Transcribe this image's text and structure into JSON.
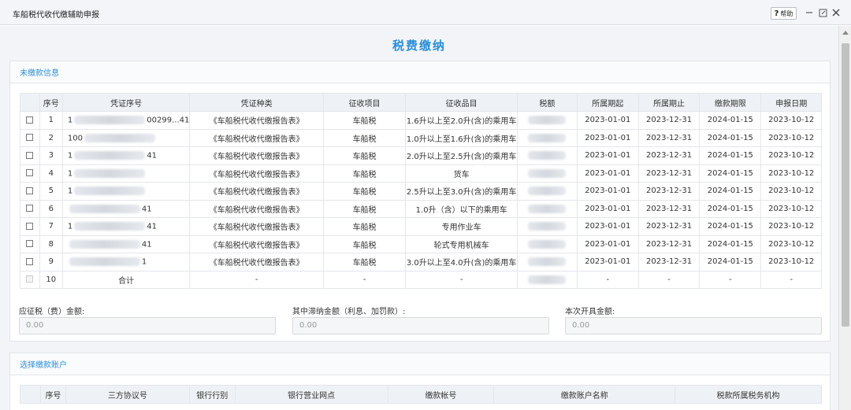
{
  "window": {
    "title": "车船税代收代缴辅助申报",
    "help_label": "帮助"
  },
  "page": {
    "title": "税费缴纳"
  },
  "unpaid": {
    "header": "未缴款信息",
    "columns": [
      "序号",
      "凭证序号",
      "凭证种类",
      "征收项目",
      "征收品目",
      "税额",
      "所属期起",
      "所属期止",
      "缴款期限",
      "申报日期"
    ],
    "rows": [
      {
        "no": "1",
        "voucher_no_visible": "1",
        "voucher_tail": "00299...41",
        "type": "《车船税代收代缴报告表》",
        "project": "车船税",
        "item": "1.6升以上至2.0升(含)的乘用车",
        "start": "2023-01-01",
        "end": "2023-12-31",
        "due": "2024-01-15",
        "date": "2023-10-12"
      },
      {
        "no": "2",
        "voucher_no_visible": "100",
        "voucher_tail": "",
        "type": "《车船税代收代缴报告表》",
        "project": "车船税",
        "item": "1.0升以上至1.6升(含)的乘用车",
        "start": "2023-01-01",
        "end": "2023-12-31",
        "due": "2024-01-15",
        "date": "2023-10-12"
      },
      {
        "no": "3",
        "voucher_no_visible": "1",
        "voucher_tail": "41",
        "type": "《车船税代收代缴报告表》",
        "project": "车船税",
        "item": "2.0升以上至2.5升(含)的乘用车",
        "start": "2023-01-01",
        "end": "2023-12-31",
        "due": "2024-01-15",
        "date": "2023-10-12"
      },
      {
        "no": "4",
        "voucher_no_visible": "1",
        "voucher_tail": "",
        "type": "《车船税代收代缴报告表》",
        "project": "车船税",
        "item": "货车",
        "start": "2023-01-01",
        "end": "2023-12-31",
        "due": "2024-01-15",
        "date": "2023-10-12"
      },
      {
        "no": "5",
        "voucher_no_visible": "1",
        "voucher_tail": "",
        "type": "《车船税代收代缴报告表》",
        "project": "车船税",
        "item": "2.5升以上至3.0升(含)的乘用车",
        "start": "2023-01-01",
        "end": "2023-12-31",
        "due": "2024-01-15",
        "date": "2023-10-12"
      },
      {
        "no": "6",
        "voucher_no_visible": "",
        "voucher_tail": "41",
        "type": "《车船税代收代缴报告表》",
        "project": "车船税",
        "item": "1.0升（含）以下的乘用车",
        "start": "2023-01-01",
        "end": "2023-12-31",
        "due": "2024-01-15",
        "date": "2023-10-12"
      },
      {
        "no": "7",
        "voucher_no_visible": "1",
        "voucher_tail": "41",
        "type": "《车船税代收代缴报告表》",
        "project": "车船税",
        "item": "专用作业车",
        "start": "2023-01-01",
        "end": "2023-12-31",
        "due": "2024-01-15",
        "date": "2023-10-12"
      },
      {
        "no": "8",
        "voucher_no_visible": "",
        "voucher_tail": "41",
        "type": "《车船税代收代缴报告表》",
        "project": "车船税",
        "item": "轮式专用机械车",
        "start": "2023-01-01",
        "end": "2023-12-31",
        "due": "2024-01-15",
        "date": "2023-10-12"
      },
      {
        "no": "9",
        "voucher_no_visible": "",
        "voucher_tail": "1",
        "type": "《车船税代收代缴报告表》",
        "project": "车船税",
        "item": "3.0升以上至4.0升(含)的乘用车",
        "start": "2023-01-01",
        "end": "2023-12-31",
        "due": "2024-01-15",
        "date": "2023-10-12"
      }
    ],
    "total_row": {
      "no": "10",
      "label": "合计",
      "dash": "-"
    }
  },
  "amounts": {
    "tax_label": "应征税（费）金额:",
    "tax_value": "0.00",
    "late_label": "其中滞纳金额（利息、加罚款）:",
    "late_value": "0.00",
    "invoice_label": "本次开具金额:",
    "invoice_value": "0.00"
  },
  "account": {
    "header": "选择缴款账户",
    "columns": [
      "序号",
      "三方协议号",
      "银行行别",
      "银行营业网点",
      "缴款帐号",
      "缴款账户名称",
      "税款所属税务机构"
    ]
  },
  "colors": {
    "accent": "#2a8fd9"
  }
}
